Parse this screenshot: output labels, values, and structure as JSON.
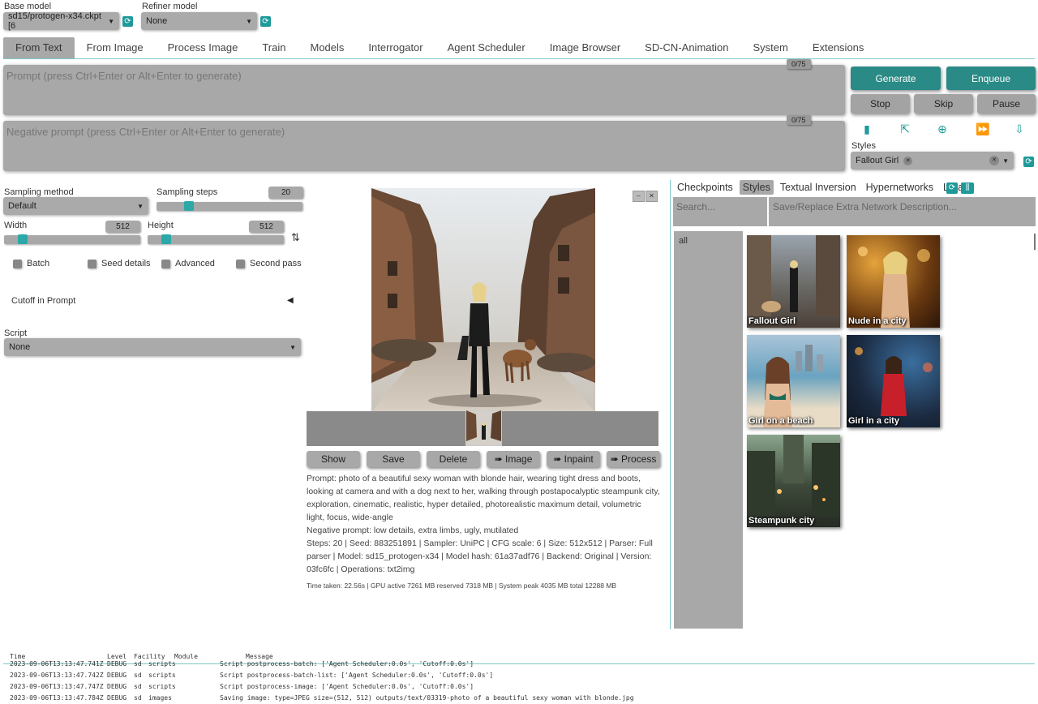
{
  "models": {
    "base_label": "Base model",
    "base_value": "sd15/protogen-x34.ckpt [6",
    "refiner_label": "Refiner model",
    "refiner_value": "None"
  },
  "tabs": [
    "From Text",
    "From Image",
    "Process Image",
    "Train",
    "Models",
    "Interrogator",
    "Agent Scheduler",
    "Image Browser",
    "SD-CN-Animation",
    "System",
    "Extensions"
  ],
  "prompt": {
    "placeholder": "Prompt (press Ctrl+Enter or Alt+Enter to generate)",
    "counter": "0/75"
  },
  "negative": {
    "placeholder": "Negative prompt (press Ctrl+Enter or Alt+Enter to generate)",
    "counter": "0/75"
  },
  "buttons": {
    "generate": "Generate",
    "enqueue": "Enqueue",
    "stop": "Stop",
    "skip": "Skip",
    "pause": "Pause"
  },
  "styles": {
    "label": "Styles",
    "chip": "Fallout Girl",
    "chip_remove": "✕",
    "clear": "✕"
  },
  "sampling": {
    "method_label": "Sampling method",
    "method_value": "Default",
    "steps_label": "Sampling steps",
    "steps_value": "20",
    "steps_fraction": 0.2
  },
  "size": {
    "width_label": "Width",
    "width_value": "512",
    "height_label": "Height",
    "height_value": "512",
    "swap": "⇅"
  },
  "checkboxes": [
    "Batch",
    "Seed details",
    "Advanced",
    "Second pass"
  ],
  "cutoff": {
    "label": "Cutoff in Prompt",
    "arrow": "◀"
  },
  "script": {
    "label": "Script",
    "value": "None"
  },
  "gallery_controls": {
    "min": "–",
    "close": "✕"
  },
  "actions": [
    "Show",
    "Save",
    "Delete",
    "➠ Image",
    "➠ Inpaint",
    "➠ Process"
  ],
  "info": {
    "prompt": "Prompt: photo of a beautiful sexy woman with blonde hair, wearing tight dress and boots, looking at camera and with a dog next to her, walking through postapocalyptic steampunk city, exploration, cinematic, realistic, hyper detailed, photorealistic maximum detail, volumetric light, focus, wide-angle",
    "negative": "Negative prompt: low details, extra limbs, ugly, mutilated",
    "params": "Steps: 20 | Seed: 883251891 | Sampler: UniPC | CFG scale: 6 | Size: 512x512 | Parser: Full parser | Model: sd15_protogen-x34 | Model hash: 61a37adf76 | Backend: Original | Version: 03fc6fc | Operations: txt2img",
    "timing": "Time taken: 22.56s | GPU active 7261 MB reserved 7318 MB | System peak 4035 MB total 12288 MB"
  },
  "networks": {
    "tabs": [
      "Checkpoints",
      "Styles",
      "Textual Inversion",
      "Hypernetworks",
      "Lora"
    ],
    "search_placeholder": "Search...",
    "desc_placeholder": "Save/Replace Extra Network Description...",
    "folder": "all",
    "cards": [
      "Fallout Girl",
      "Nude in a city",
      "Girl on a beach",
      "Girl in a city",
      "Steampunk city"
    ]
  },
  "log": {
    "headers": [
      "Time",
      "Level",
      "Facility",
      "Module",
      "Message"
    ],
    "rows": [
      [
        "2023-09-06T13:13:47.741Z",
        "DEBUG",
        "sd",
        "scripts",
        "Script postprocess-batch: ['Agent Scheduler:0.0s', 'Cutoff:0.0s']"
      ],
      [
        "2023-09-06T13:13:47.742Z",
        "DEBUG",
        "sd",
        "scripts",
        "Script postprocess-batch-list: ['Agent Scheduler:0.0s', 'Cutoff:0.0s']"
      ],
      [
        "2023-09-06T13:13:47.747Z",
        "DEBUG",
        "sd",
        "scripts",
        "Script postprocess-image: ['Agent Scheduler:0.0s', 'Cutoff:0.0s']"
      ],
      [
        "2023-09-06T13:13:47.784Z",
        "DEBUG",
        "sd",
        "images",
        "Saving image: type=JPEG size=(512, 512) outputs/text/03319-photo of a beautiful sexy woman with blonde.jpg"
      ]
    ]
  }
}
